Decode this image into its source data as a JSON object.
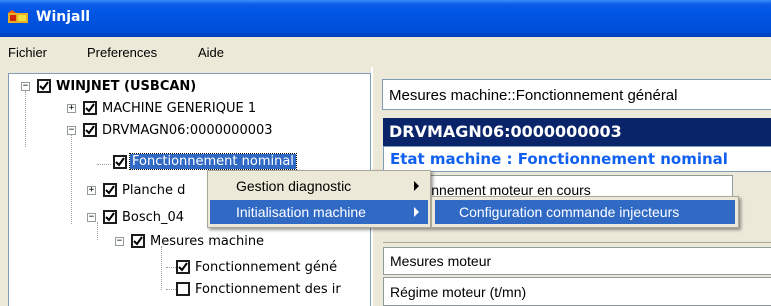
{
  "window": {
    "title": "Winjall",
    "icon": "winjall-app-icon"
  },
  "menubar": {
    "items": [
      "Fichier",
      "Preferences",
      "Aide"
    ]
  },
  "tree": {
    "root": "WINJNET (USBCAN)",
    "node_machine_generique": "MACHINE GENERIQUE 1",
    "node_drvmagn": "DRVMAGN06:0000000003",
    "node_fonctionnement_nominal": "Fonctionnement nominal",
    "node_planche": "Planche d",
    "node_bosch": "Bosch_04",
    "node_mesures_machine": "Mesures machine",
    "node_fonct_gen": "Fonctionnement géné",
    "node_fonct_des": "Fonctionnement des ir"
  },
  "right_pane": {
    "header": "Mesures machine::Fonctionnement général",
    "device": "DRVMAGN06:0000000003",
    "etat": "Etat machine : Fonctionnement nominal",
    "tab": "fonctionnement moteur en cours",
    "section": "Mesures moteur",
    "row": "Régime moteur (t/mn)"
  },
  "context_menu": {
    "items": [
      "Gestion diagnostic",
      "Initialisation machine"
    ]
  },
  "submenu": {
    "items": [
      "Configuration commande injecteurs"
    ]
  },
  "colors": {
    "titlebar": "#0054e3",
    "selection": "#316ac5",
    "device_bar": "#0a246a",
    "etat_text": "#1060f0"
  }
}
